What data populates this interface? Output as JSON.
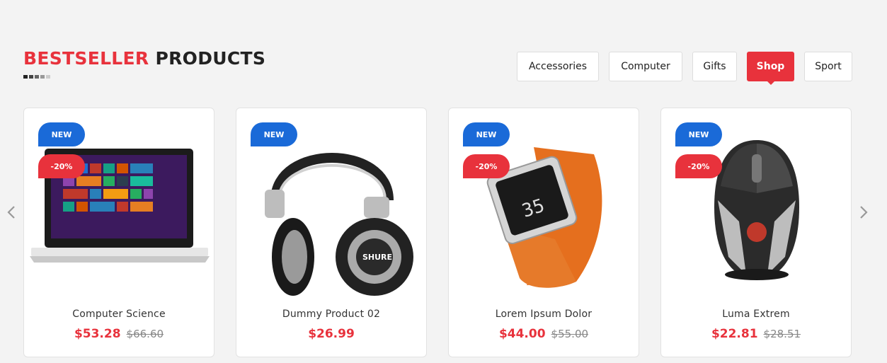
{
  "section": {
    "title_accent": "BESTSELLER",
    "title_rest": "PRODUCTS"
  },
  "tabs": [
    {
      "label": "Accessories"
    },
    {
      "label": "Computer"
    },
    {
      "label": "Gifts"
    },
    {
      "label": "Shop"
    },
    {
      "label": "Sport"
    }
  ],
  "active_tab": "Shop",
  "products": [
    {
      "name": "Computer Science",
      "price": "$53.28",
      "old_price": "$66.60",
      "badge_new": "NEW",
      "badge_sale": "-20%",
      "image": "laptop"
    },
    {
      "name": "Dummy Product 02",
      "price": "$26.99",
      "old_price": "",
      "badge_new": "NEW",
      "badge_sale": "",
      "image": "headphones"
    },
    {
      "name": "Lorem Ipsum Dolor",
      "price": "$44.00",
      "old_price": "$55.00",
      "badge_new": "NEW",
      "badge_sale": "-20%",
      "image": "watch"
    },
    {
      "name": "Luma Extrem",
      "price": "$22.81",
      "old_price": "$28.51",
      "badge_new": "NEW",
      "badge_sale": "-20%",
      "image": "gaming-mouse"
    }
  ],
  "icons": {
    "prev": "chevron-left-icon",
    "next": "chevron-right-icon"
  },
  "colors": {
    "accent": "#e8323c",
    "badge_new": "#1a6ad8",
    "background": "#f3f3f3"
  }
}
